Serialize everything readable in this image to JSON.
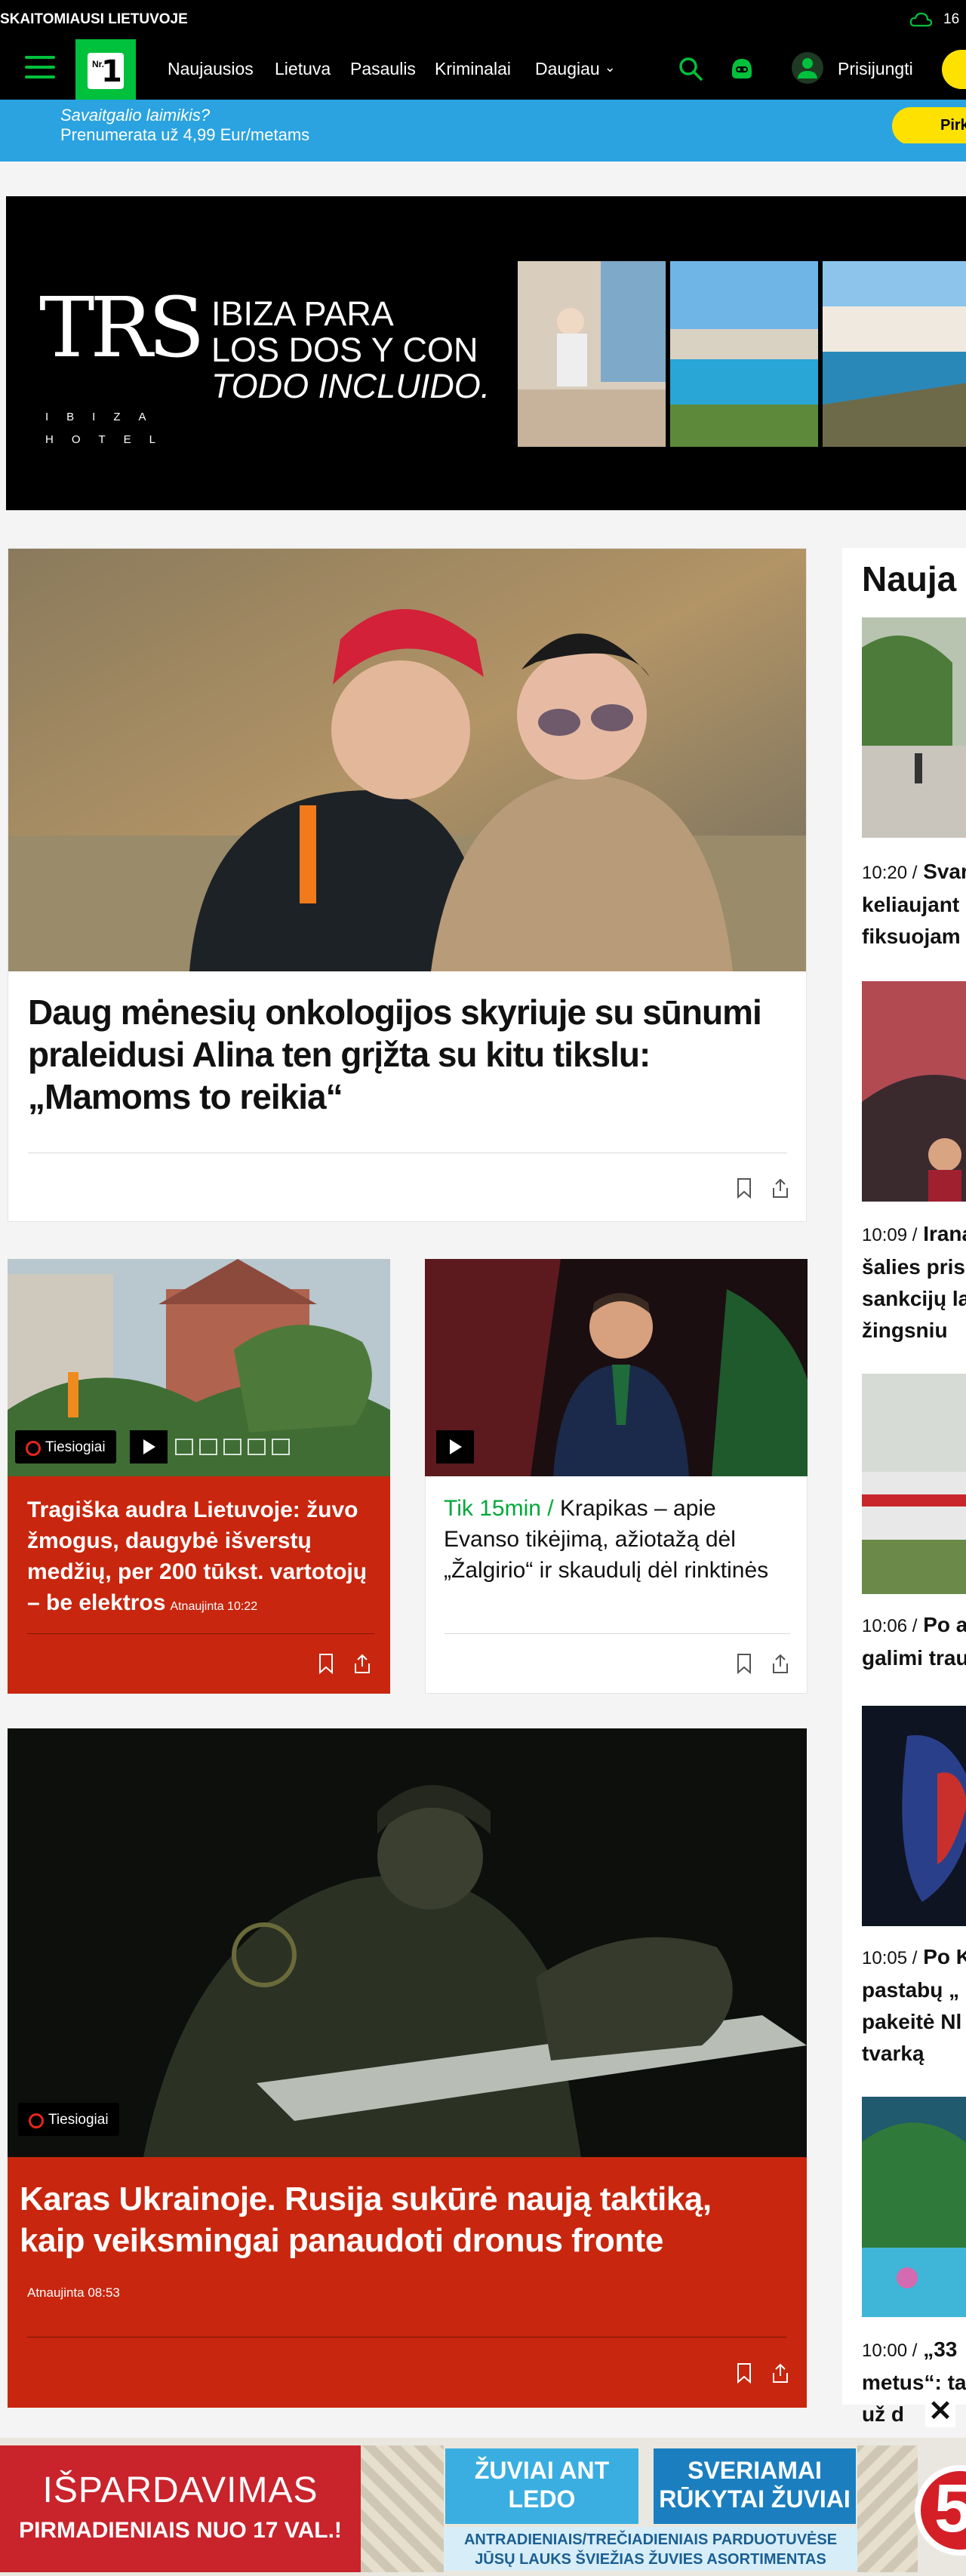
{
  "header": {
    "tagline": "SKAITOMIAUSI LIETUVOJE",
    "weather_icon": "cloud-icon",
    "temperature": "16",
    "logo": {
      "small": "Nr.",
      "big": "1"
    },
    "nav": [
      "Naujausios",
      "Lietuva",
      "Pasaulis",
      "Kriminalai",
      "Daugiau"
    ],
    "login": "Prisijungti"
  },
  "promo": {
    "question": "Savaitgalio laimikis?",
    "price": "Prenumerata už 4,99 Eur/metams",
    "button": "Pirk"
  },
  "hotel_ad": {
    "logo": "TRS",
    "logo_sub": "IBIZA HOTEL",
    "line1": "IBIZA PARA",
    "line2": "LOS DOS Y CON",
    "line3": "TODO INCLUIDO."
  },
  "lead": {
    "title": "Daug mėnesių onkologijos skyriuje su sūnumi praleidusi Alina ten grįžta su kitu tikslu: „Mamoms to reikia“"
  },
  "storm": {
    "badge": "Tiesiogiai",
    "title": "Tragiška audra Lietuvoje: žuvo žmogus, daugybė išverstų medžių, per 200 tūkst. vartotojų – be elektros",
    "updated": "Atnaujinta 10:22"
  },
  "krapikas": {
    "kicker": "Tik 15min /",
    "title": "Krapikas – apie Evanso tikėjimą, ažiotažą dėl „Žalgirio“ ir skaudulį dėl rinktinės"
  },
  "ukraine": {
    "badge": "Tiesiogiai",
    "title": "Karas Ukrainoje. Rusija sukūrė naują taktiką, kaip veiksmingai panaudoti dronus fronte",
    "updated": "Atnaujinta 08:53"
  },
  "sidebar": {
    "title": "Nauja",
    "items": [
      {
        "time": "10:20 /",
        "lines": [
          "Svar",
          "keliaujant",
          "fiksuojam"
        ]
      },
      {
        "time": "10:09 /",
        "lines": [
          "Irana",
          "šalies pris",
          "sankcijų la",
          "žingsniu"
        ]
      },
      {
        "time": "10:06 /",
        "lines": [
          "Po a",
          "galimi trau"
        ]
      },
      {
        "time": "10:05 /",
        "lines": [
          "Po K",
          "pastabų „",
          "pakeitė Nl",
          "tvarką"
        ]
      },
      {
        "time": "10:00 /",
        "lines": [
          "„33",
          "metus“: ta",
          "už d"
        ]
      }
    ]
  },
  "bottom_ad": {
    "sale": "IŠPARDAVIMAS",
    "when": "PIRMADIENIAIS NUO 17 VAL.!",
    "box1": "ŽUVIAI ANT LEDO",
    "box2": "SVERIAMAI RŪKYTAI ŽUVIAI",
    "line1": "ANTRADIENIAIS/TREČIADIENIAIS PARDUOTUVĖSE",
    "line2": "JŪSŲ LAUKS ŠVIEŽIAS ŽUVIES ASORTIMENTAS",
    "badge": "5"
  },
  "colors": {
    "brand_green": "#00c13c",
    "accent_yellow": "#ffe100",
    "live_red": "#c8260e",
    "promo_blue": "#2aa3e0"
  }
}
